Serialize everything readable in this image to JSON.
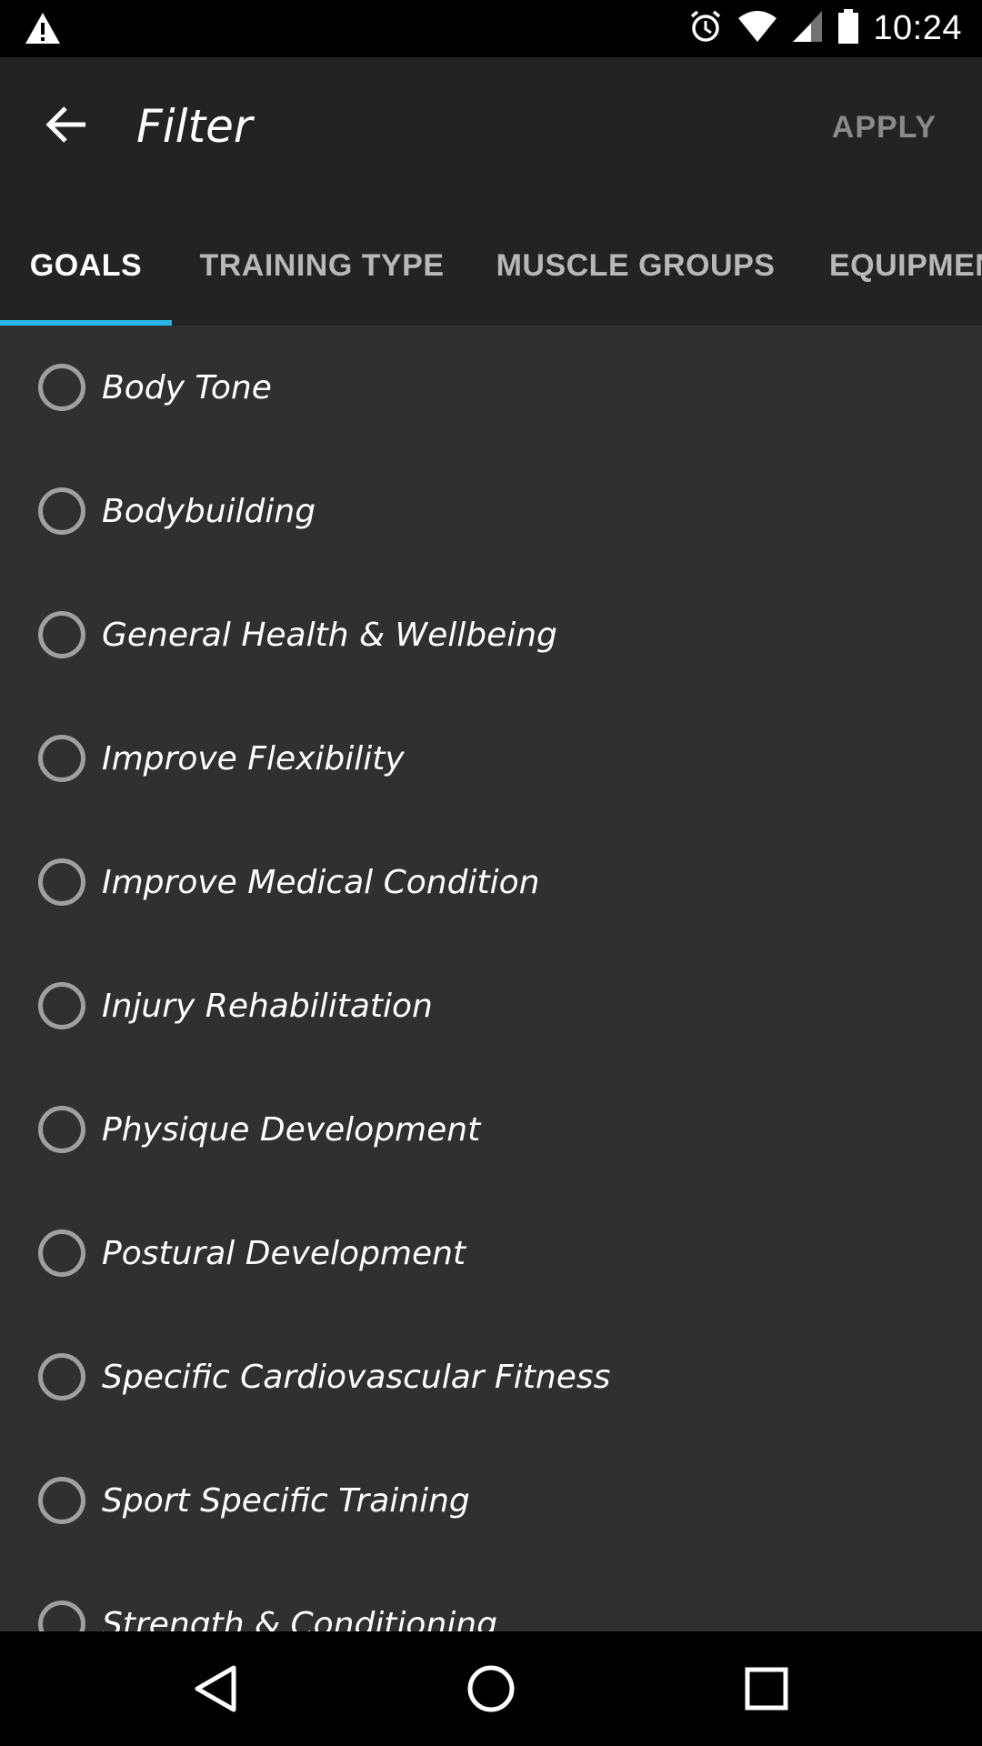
{
  "status_bar": {
    "time": "10:24",
    "icons": [
      "warning-icon",
      "alarm-icon",
      "wifi-icon",
      "signal-icon",
      "battery-icon"
    ]
  },
  "app_bar": {
    "title": "Filter",
    "apply_label": "APPLY"
  },
  "tabs": [
    {
      "label": "GOALS",
      "active": true
    },
    {
      "label": "TRAINING TYPE",
      "active": false
    },
    {
      "label": "MUSCLE GROUPS",
      "active": false
    },
    {
      "label": "EQUIPMENT",
      "active": false
    }
  ],
  "goals": [
    {
      "label": "Body Tone",
      "selected": false
    },
    {
      "label": "Bodybuilding",
      "selected": false
    },
    {
      "label": "General Health & Wellbeing",
      "selected": false
    },
    {
      "label": "Improve Flexibility",
      "selected": false
    },
    {
      "label": "Improve Medical Condition",
      "selected": false
    },
    {
      "label": "Injury Rehabilitation",
      "selected": false
    },
    {
      "label": "Physique Development",
      "selected": false
    },
    {
      "label": "Postural Development",
      "selected": false
    },
    {
      "label": "Specific Cardiovascular Fitness",
      "selected": false
    },
    {
      "label": "Sport Specific Training",
      "selected": false
    },
    {
      "label": "Strength & Conditioning",
      "selected": false
    }
  ],
  "colors": {
    "tab_indicator": "#29b6e8",
    "background": "#303030",
    "app_bar": "#232323"
  },
  "nav_bar": {
    "buttons": [
      "back-nav-icon",
      "home-nav-icon",
      "recents-nav-icon"
    ]
  }
}
